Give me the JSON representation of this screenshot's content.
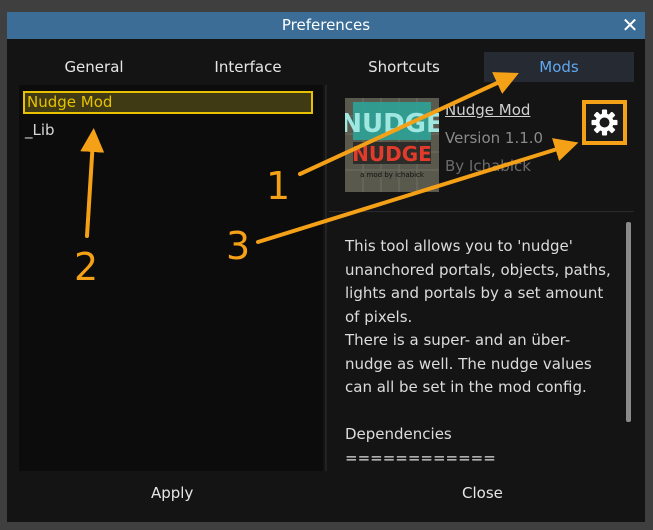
{
  "window": {
    "title": "Preferences"
  },
  "tabs": [
    {
      "label": "General"
    },
    {
      "label": "Interface"
    },
    {
      "label": "Shortcuts"
    },
    {
      "label": "Mods"
    }
  ],
  "mod_list": [
    "Nudge Mod",
    "_Lib"
  ],
  "details": {
    "name": "Nudge Mod",
    "version": "Version 1.1.0",
    "author": "By Ichabick",
    "thumbnail": {
      "title_top": "NUDGE",
      "title_red": "NUDGE",
      "caption": "a mod by ichabick"
    },
    "description": [
      "This tool allows you to 'nudge' unanchored portals, objects, paths, lights and portals by a set amount of pixels.",
      "There is a super- and an über-nudge as well. The nudge values can all be set in the mod config.",
      "",
      "Dependencies",
      "============"
    ]
  },
  "buttons": {
    "apply": "Apply",
    "close": "Close"
  },
  "annotations": [
    "1",
    "2",
    "3"
  ],
  "colors": {
    "titlebar": "#3b6d97",
    "highlight": "#e8c200",
    "annotation": "#f5a117",
    "active_tab_text": "#5fa8f0"
  }
}
